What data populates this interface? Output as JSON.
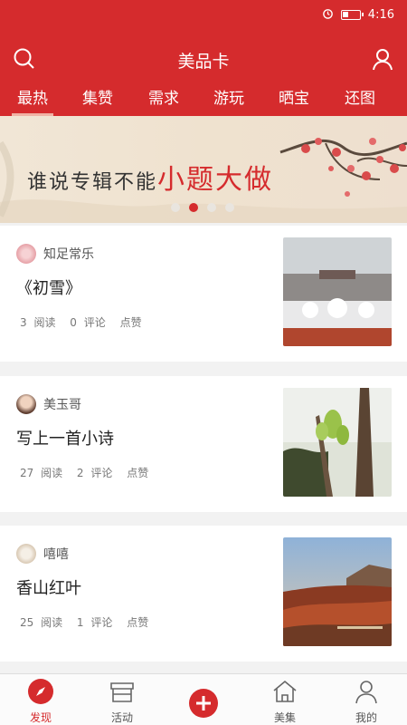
{
  "status": {
    "time": "4:16"
  },
  "header": {
    "title": "美品卡"
  },
  "tabs": [
    {
      "label": "最热"
    },
    {
      "label": "集赞"
    },
    {
      "label": "需求"
    },
    {
      "label": "游玩"
    },
    {
      "label": "晒宝"
    },
    {
      "label": "还图"
    }
  ],
  "banner": {
    "text_small": "谁说专辑不能",
    "text_big": "小题大做"
  },
  "posts": [
    {
      "author": "知足常乐",
      "title": "《初雪》",
      "reads": "3 阅读",
      "comments": "0 评论",
      "like": "点赞"
    },
    {
      "author": "美玉哥",
      "title": "写上一首小诗",
      "reads": "27 阅读",
      "comments": "2 评论",
      "like": "点赞"
    },
    {
      "author": "嘻嘻",
      "title": "香山红叶",
      "reads": "25 阅读",
      "comments": "1 评论",
      "like": "点赞"
    }
  ],
  "nav": {
    "discover": "发现",
    "activity": "活动",
    "collection": "美集",
    "mine": "我的"
  },
  "colors": {
    "brand": "#d52b2d"
  }
}
